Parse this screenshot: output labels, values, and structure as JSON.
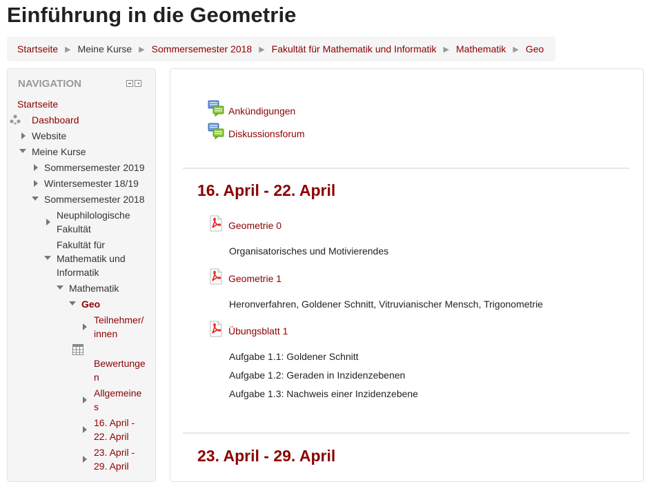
{
  "page": {
    "title": "Einführung in die Geometrie"
  },
  "breadcrumb": [
    {
      "label": "Startseite"
    },
    {
      "label": "Meine Kurse"
    },
    {
      "label": "Sommersemester 2018"
    },
    {
      "label": "Fakultät für Mathematik und Informatik"
    },
    {
      "label": "Mathematik"
    },
    {
      "label": "Geo"
    }
  ],
  "navigation": {
    "header": "NAVIGATION",
    "startseite": "Startseite",
    "dashboard": "Dashboard",
    "website": "Website",
    "meine_kurse": "Meine Kurse",
    "ss2019": "Sommersemester 2019",
    "ws1819": "Wintersemester 18/19",
    "ss2018": "Sommersemester 2018",
    "neuphil_1": "Neuphilologische",
    "neuphil_2": "Fakultät",
    "fmi_1": "Fakultät für",
    "fmi_2": "Mathematik und",
    "fmi_3": "Informatik",
    "mathematik": "Mathematik",
    "geo": "Geo",
    "teilnehmer_1": "Teilnehmer/",
    "teilnehmer_2": "innen",
    "bewertungen_1": "Bewertunge",
    "bewertungen_2": "n",
    "allgemeines_1": "Allgemeine",
    "allgemeines_2": "s",
    "week1_1": "16. April -",
    "week1_2": "22. April",
    "week2_1": "23. April -",
    "week2_2": "29. April"
  },
  "main": {
    "forums": [
      {
        "label": "Ankündigungen",
        "icon": "forum-icon"
      },
      {
        "label": "Diskussionsforum",
        "icon": "forum-icon"
      }
    ],
    "sections": [
      {
        "title": "16. April - 22. April",
        "items": [
          {
            "label": "Geometrie 0",
            "icon": "pdf-icon",
            "desc": "Organisatorisches und Motivierendes"
          },
          {
            "label": "Geometrie 1",
            "icon": "pdf-icon",
            "desc": "Heronverfahren, Goldener Schnitt, Vitruvianischer Mensch, Trigonometrie"
          },
          {
            "label": "Übungsblatt 1",
            "icon": "pdf-icon",
            "desc_lines": [
              "Aufgabe 1.1: Goldener Schnitt",
              "Aufgabe 1.2: Geraden in Inzidenzebenen",
              "Aufgabe 1.3: Nachweis einer Inzidenzebene"
            ]
          }
        ]
      },
      {
        "title": "23. April - 29. April"
      }
    ]
  },
  "colors": {
    "link": "#8b0000",
    "breadcrumb_bg": "#f5f5f5",
    "nav_bg": "#f5f5f5",
    "divider": "#e6e6e6"
  }
}
